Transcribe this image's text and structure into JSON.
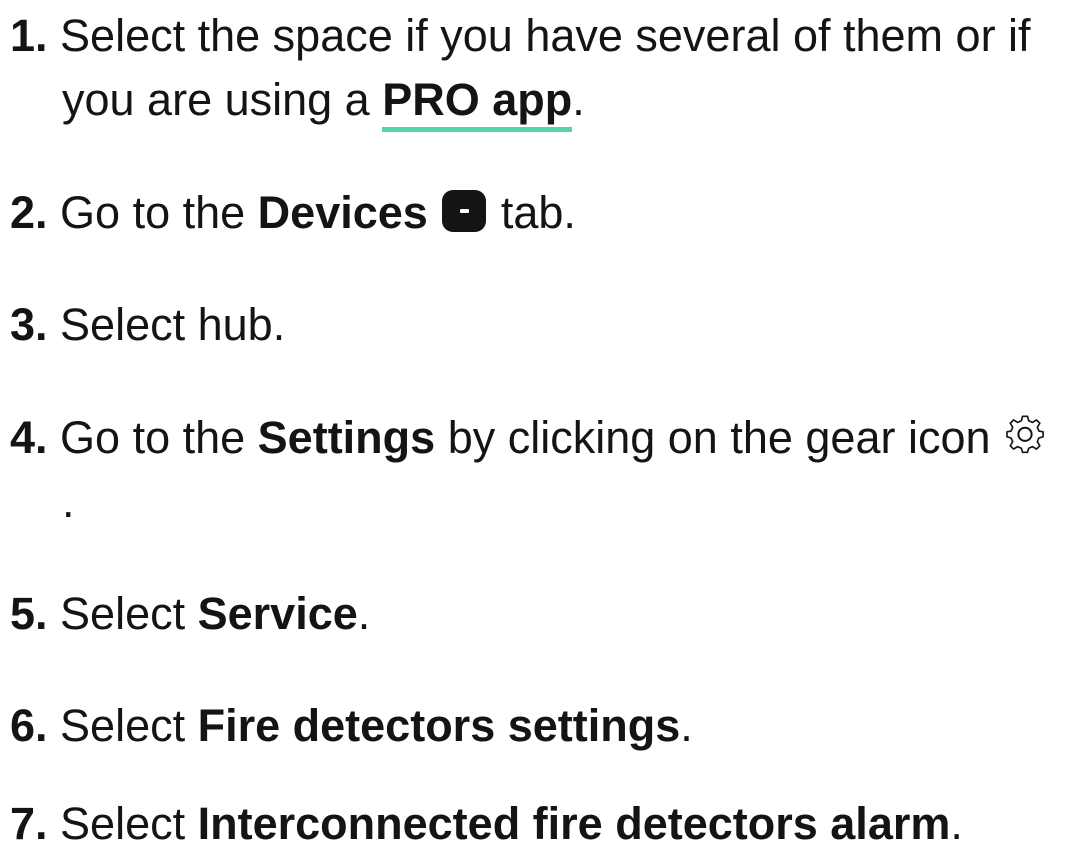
{
  "steps": [
    {
      "num": "1.",
      "line1": "Select the space if you have several of them or if",
      "line2_pre": "you are using a ",
      "link": "PRO app",
      "line2_post": "."
    },
    {
      "num": "2.",
      "pre": "Go to the ",
      "bold": "Devices",
      "icon": "devices-icon",
      "post": " tab."
    },
    {
      "num": "3.",
      "text": "Select hub."
    },
    {
      "num": "4.",
      "pre": "Go to the ",
      "bold": "Settings",
      "mid": " by clicking on the gear icon ",
      "icon": "gear-icon",
      "line2": "."
    },
    {
      "num": "5.",
      "pre": "Select ",
      "bold": "Service",
      "post": "."
    },
    {
      "num": "6.",
      "pre": "Select ",
      "bold": "Fire detectors settings",
      "post": "."
    },
    {
      "num": "7.",
      "pre": "Select ",
      "bold": "Interconnected fire detectors alarm",
      "post": "."
    }
  ],
  "colors": {
    "text": "#141414",
    "link_underline": "#52d6a3",
    "background": "#ffffff"
  }
}
